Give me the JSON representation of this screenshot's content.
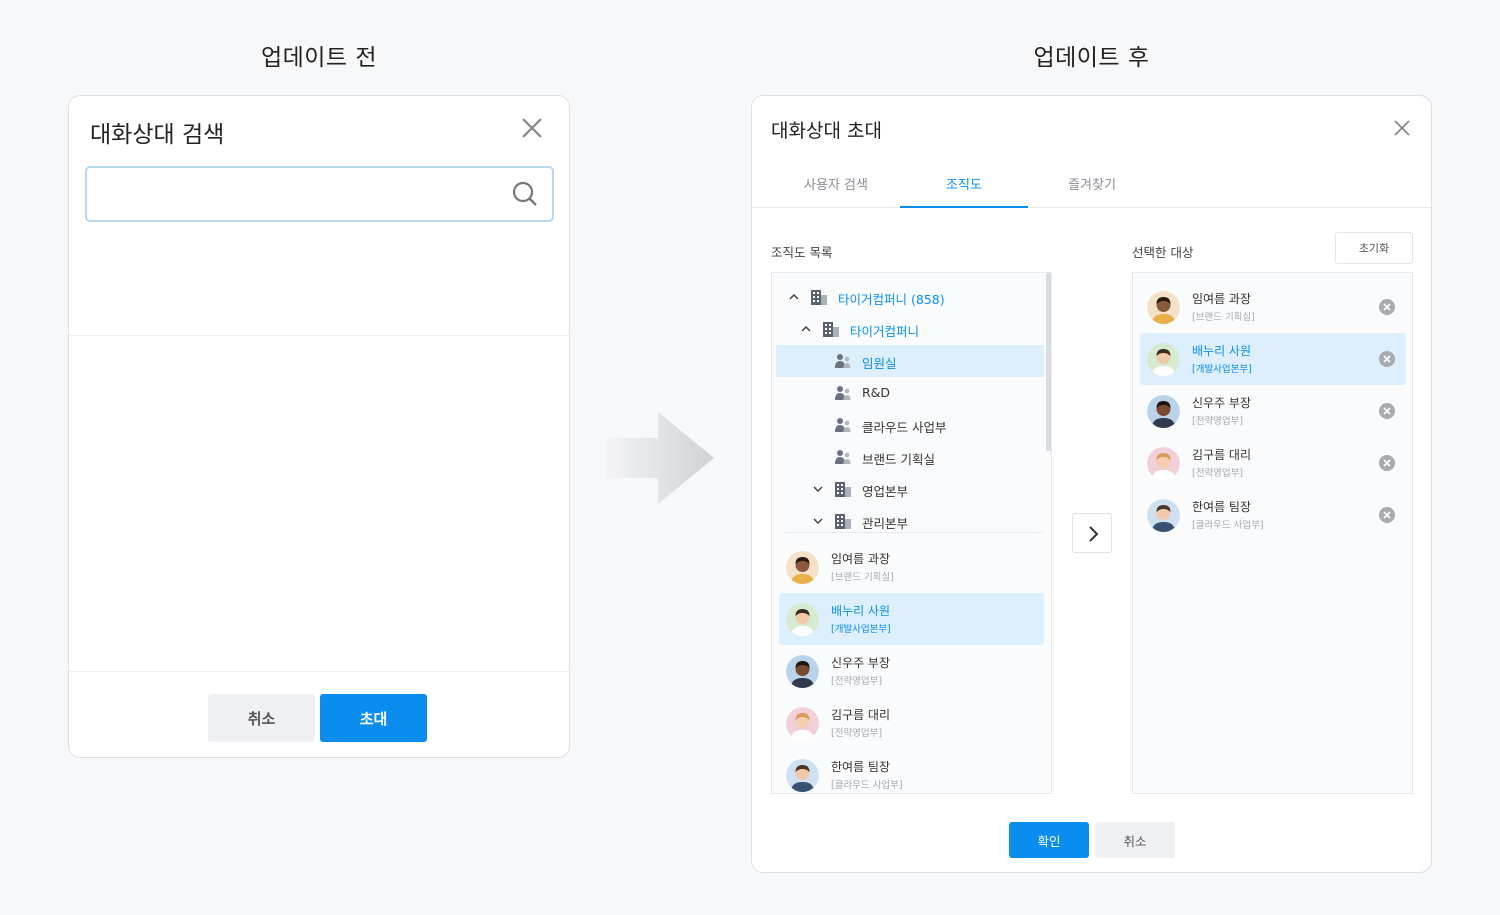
{
  "captions": {
    "before": "업데이트 전",
    "after": "업데이트 후"
  },
  "before": {
    "title": "대화상대 검색",
    "search": {
      "value": "",
      "placeholder": ""
    },
    "cancel_label": "취소",
    "invite_label": "초대"
  },
  "after": {
    "title": "대화상대 초대",
    "tabs": [
      {
        "label": "사용자 검색",
        "active": false
      },
      {
        "label": "조직도",
        "active": true
      },
      {
        "label": "즐겨찾기",
        "active": false
      }
    ],
    "org_label": "조직도 목록",
    "selected_label": "선택한 대상",
    "reset_label": "초기화",
    "tree": [
      {
        "label": "타이거컴퍼니 (858)",
        "icon": "building-icon",
        "chevron": "up",
        "level": 0,
        "highlight": true,
        "selected": false
      },
      {
        "label": "타이거컴퍼니",
        "icon": "building-icon",
        "chevron": "up",
        "level": 1,
        "highlight": true,
        "selected": false
      },
      {
        "label": "임원실",
        "icon": "people-icon",
        "chevron": "",
        "level": 2,
        "highlight": true,
        "selected": true
      },
      {
        "label": "R&D",
        "icon": "people-icon",
        "chevron": "",
        "level": 2,
        "highlight": false,
        "selected": false
      },
      {
        "label": "클라우드 사업부",
        "icon": "people-icon",
        "chevron": "",
        "level": 2,
        "highlight": false,
        "selected": false
      },
      {
        "label": "브랜드 기획실",
        "icon": "people-icon",
        "chevron": "",
        "level": 2,
        "highlight": false,
        "selected": false
      },
      {
        "label": "영업본부",
        "icon": "building-icon",
        "chevron": "down",
        "level": 2,
        "highlight": false,
        "selected": false
      },
      {
        "label": "관리본부",
        "icon": "building-icon",
        "chevron": "down",
        "level": 2,
        "highlight": false,
        "selected": false
      }
    ],
    "people": [
      {
        "name": "임여름 과장",
        "dept": "[브랜드 기획실]",
        "selected": false
      },
      {
        "name": "배누리 사원",
        "dept": "[개발사업본부]",
        "selected": true
      },
      {
        "name": "신우주 부장",
        "dept": "[전략영업부]",
        "selected": false
      },
      {
        "name": "김구름 대리",
        "dept": "[전략영업부]",
        "selected": false
      },
      {
        "name": "한여름 팀장",
        "dept": "[클라우드 사업부]",
        "selected": false
      }
    ],
    "selected_people": [
      {
        "name": "임여름 과장",
        "dept": "[브랜드 기획실]",
        "selected": false
      },
      {
        "name": "배누리 사원",
        "dept": "[개발사업본부]",
        "selected": true
      },
      {
        "name": "신우주 부장",
        "dept": "[전략영업부]",
        "selected": false
      },
      {
        "name": "김구름 대리",
        "dept": "[전략영업부]",
        "selected": false
      },
      {
        "name": "한여름 팀장",
        "dept": "[클라우드 사업부]",
        "selected": false
      }
    ],
    "ok_label": "확인",
    "cancel_label": "취소"
  },
  "colors": {
    "accent": "#0a8dee",
    "selected_bg": "#ddeffd",
    "border": "#dcdfe4"
  }
}
